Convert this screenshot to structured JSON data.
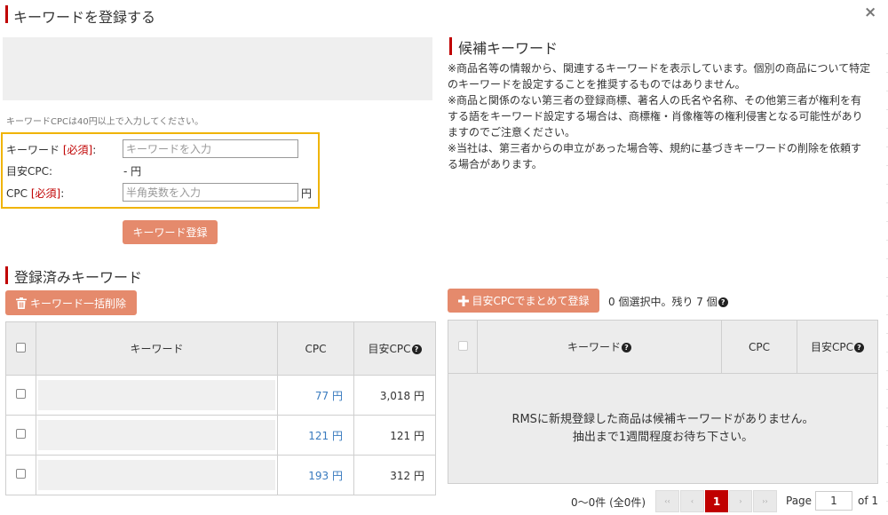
{
  "dialog": {
    "title": "キーワードを登録する",
    "close_glyph": "×"
  },
  "form": {
    "hint": "キーワードCPCは40円以上で入力してください。",
    "keyword_label": "キーワード",
    "required": "[必須]",
    "label_colon": ":",
    "keyword_placeholder": "キーワードを入力",
    "est_cpc_label": "目安CPC:",
    "est_cpc_value": "- 円",
    "cpc_label": "CPC",
    "cpc_placeholder": "半角英数を入力",
    "cpc_unit": "円",
    "submit_label": "キーワード登録"
  },
  "candidate": {
    "title": "候補キーワード",
    "notices": [
      "※商品名等の情報から、関連するキーワードを表示しています。個別の商品について特定のキーワードを設定することを推奨するものではありません。",
      "※商品と関係のない第三者の登録商標、著名人の氏名や名称、その他第三者が権利を有する語をキーワード設定する場合は、商標権・肖像権等の権利侵害となる可能性がありますのでご注意ください。",
      "※当社は、第三者からの申立があった場合等、規約に基づきキーワードの削除を依頼する場合があります。"
    ],
    "bulk_button": "目安CPCでまとめて登録",
    "selection_status": "0 個選択中。残り 7 個",
    "col_keyword": "キーワード",
    "col_cpc": "CPC",
    "col_est": "目安CPC",
    "empty_line1": "RMSに新規登録した商品は候補キーワードがありません。",
    "empty_line2": "抽出まで1週間程度お待ち下さい。"
  },
  "registered": {
    "title": "登録済みキーワード",
    "delete_button": "キーワード一括削除",
    "col_keyword": "キーワード",
    "col_cpc": "CPC",
    "col_est": "目安CPC",
    "rows": [
      {
        "cpc": "77 円",
        "est": "3,018 円"
      },
      {
        "cpc": "121 円",
        "est": "121 円"
      },
      {
        "cpc": "193 円",
        "est": "312 円"
      }
    ]
  },
  "pagination": {
    "range": "0〜0件 (全0件)",
    "first": "‹‹",
    "prev": "‹",
    "current": "1",
    "next": "›",
    "last": "››",
    "page_label": "Page",
    "page_value": "1",
    "of_label": "of 1"
  },
  "colors": {
    "accent": "#c00000",
    "button": "#e58a6c",
    "highlight_border": "#f0b400",
    "link": "#3a7bbf"
  },
  "icons": [
    "close-icon",
    "trash-icon",
    "plus-icon",
    "help-icon"
  ]
}
